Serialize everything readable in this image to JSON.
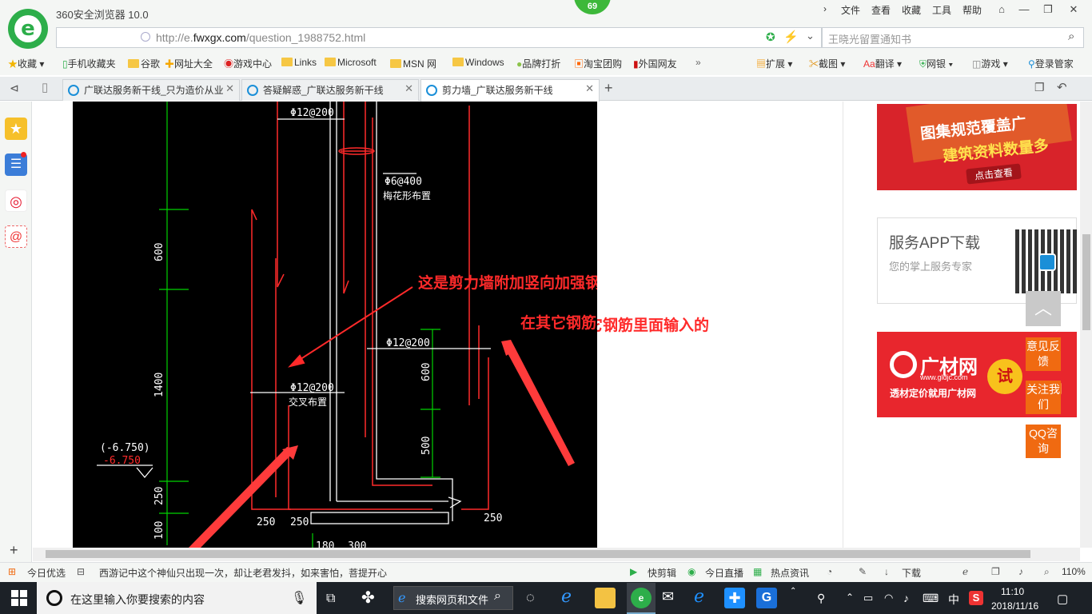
{
  "browser": {
    "app_name": "360安全浏览器 10.0",
    "badge_count": "69",
    "menus": [
      "文件",
      "查看",
      "收藏",
      "工具",
      "帮助"
    ],
    "url_prefix": "http://e.",
    "url_domain": "fwxgx.com",
    "url_path": "/question_1988752.html",
    "search_placeholder": "王晓光留置通知书"
  },
  "favorites": [
    {
      "label": "收藏",
      "icon": "star-icon"
    },
    {
      "label": "手机收藏夹",
      "icon": "phone-icon"
    },
    {
      "label": "谷歌",
      "icon": "folder-icon"
    },
    {
      "label": "网址大全",
      "icon": "globe-icon"
    },
    {
      "label": "游戏中心",
      "icon": "game-icon"
    },
    {
      "label": "Links",
      "icon": "folder-icon"
    },
    {
      "label": "Microsoft",
      "icon": "folder-icon"
    },
    {
      "label": "MSN 网",
      "icon": "folder-icon"
    },
    {
      "label": "Windows",
      "icon": "folder-icon"
    },
    {
      "label": "品牌打折",
      "icon": "leaf-icon"
    },
    {
      "label": "淘宝团购",
      "icon": "taobao-icon"
    },
    {
      "label": "外国网友",
      "icon": "bookmark-icon"
    }
  ],
  "tools": [
    "扩展",
    "截图",
    "翻译",
    "网银",
    "游戏",
    "登录管家"
  ],
  "tabs": [
    {
      "label": "广联达服务新干线_只为造价从业",
      "active": false
    },
    {
      "label": "答疑解惑_广联达服务新干线",
      "active": false
    },
    {
      "label": "剪力墙_广联达服务新干线",
      "active": true
    }
  ],
  "cad": {
    "labels": {
      "top_bar": "Φ12@200",
      "stirrup": "Φ6@400",
      "stirrup_note": "梅花形布置",
      "dim_600_left": "600",
      "dim_1400": "1400",
      "elev_black": "(-6.750)",
      "elev_red": "-6.750",
      "dim_250_left": "250",
      "dim_100": "100",
      "mid_bar": "Φ12@200",
      "mid_note": "交叉布置",
      "right_bar": "Φ12@200",
      "dim_600_right": "600",
      "dim_500": "500",
      "bottom_250_a": "250",
      "bottom_250_b": "250",
      "right_250": "250",
      "bottom_180": "180",
      "bottom_300": "300"
    },
    "annotation_1": "这是剪力墙附加竖向加强钢筋",
    "annotation_2": "在其它钢筋里面输入的"
  },
  "ads": {
    "ad1_line1": "图集规范覆盖广",
    "ad1_line2": "建筑资料数量多",
    "ad1_btn": "点击查看",
    "ad2_title": "服务APP下载",
    "ad2_sub": "您的掌上服务专家",
    "ad3_brand": "广材网",
    "ad3_url": "www.gldjc.com",
    "ad3_slogan": "透材定价就用广材网",
    "ad3_try": "试",
    "ad3_partial": "试用"
  },
  "side_buttons": [
    "意见反馈",
    "关注我们",
    "QQ咨询"
  ],
  "status": {
    "today": "今日优选",
    "news": "西游记中这个神仙只出现一次，却让老君发抖，如来害怕，菩提开心",
    "items": [
      "快剪辑",
      "今日直播",
      "热点资讯"
    ],
    "download": "下载",
    "zoom": "110%"
  },
  "taskbar": {
    "search_placeholder": "在这里输入你要搜索的内容",
    "web_search": "搜索网页和文件",
    "ime": "中",
    "time": "11:10",
    "date": "2018/11/16"
  },
  "colors": {
    "accent": "#2dae4a",
    "orange": "#f06a11",
    "cad_red": "#ff2a2a",
    "cad_green": "#00d200"
  }
}
